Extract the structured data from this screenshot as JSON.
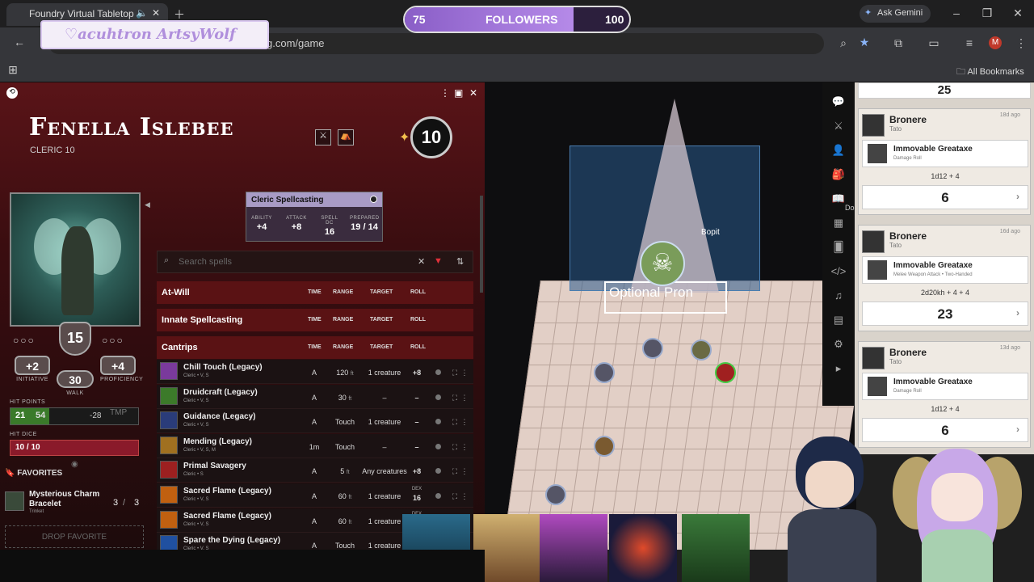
{
  "browser": {
    "tab_title": "Foundry Virtual Tabletop",
    "url": "g.com/game",
    "ask_gemini": "Ask Gemini",
    "all_bookmarks": "All Bookmarks",
    "profile_initial": "M"
  },
  "stream": {
    "banner": "♡acuhtron  ArtsyWolf",
    "followers_label": "FOLLOWERS",
    "followers_current": "75",
    "followers_goal": "100",
    "followers_progress": 0.75
  },
  "sheet": {
    "name": "Fenella Islebee",
    "class_level": "CLERIC 10",
    "level_badge": "10",
    "ac": "15",
    "initiative": "+2",
    "initiative_label": "INITIATIVE",
    "proficiency": "+4",
    "proficiency_label": "PROFICIENCY",
    "walk": "30",
    "walk_label": "WALK",
    "hp_label": "HIT POINTS",
    "hp_current": "21",
    "hp_max": "54",
    "hp_temp_mod": "-28",
    "hp_tmp": "TMP",
    "hd_label": "HIT DICE",
    "hd_value": "10 / 10",
    "favorites_label": "FAVORITES",
    "favorite_item": "Mysterious Charm Bracelet",
    "favorite_type": "Trinket",
    "favorite_uses": "3",
    "favorite_max": "3",
    "drop_favorite": "DROP FAVORITE",
    "casting": {
      "title": "Cleric Spellcasting",
      "ability_label": "ABILITY",
      "ability": "+4",
      "attack_label": "ATTACK",
      "attack": "+8",
      "dc_label": "SPELL DC",
      "dc": "16",
      "prepared_label": "PREPARED",
      "prepared": "19 / 14"
    },
    "search_placeholder": "Search spells",
    "col_time": "TIME",
    "col_range": "RANGE",
    "col_target": "TARGET",
    "col_roll": "ROLL",
    "sections": [
      "At-Will",
      "Innate Spellcasting",
      "Cantrips"
    ],
    "spells": [
      {
        "name": "Chill Touch (Legacy)",
        "sub": "Cleric • V, S",
        "time": "A",
        "range": "120",
        "unit": "ft",
        "target": "1 creature",
        "roll": "+8",
        "color": "#7a3a9c"
      },
      {
        "name": "Druidcraft (Legacy)",
        "sub": "Cleric • V, S",
        "time": "A",
        "range": "30",
        "unit": "ft",
        "target": "–",
        "roll": "–",
        "color": "#3c7a2a"
      },
      {
        "name": "Guidance (Legacy)",
        "sub": "Cleric • V, S",
        "time": "A",
        "range": "Touch",
        "unit": "",
        "target": "1 creature",
        "roll": "–",
        "color": "#2a3c7a"
      },
      {
        "name": "Mending (Legacy)",
        "sub": "Cleric • V, S, M",
        "time": "1m",
        "range": "Touch",
        "unit": "",
        "target": "–",
        "roll": "–",
        "color": "#a07020"
      },
      {
        "name": "Primal Savagery",
        "sub": "Cleric • S",
        "time": "A",
        "range": "5",
        "unit": "ft",
        "target": "Any creatures",
        "roll": "+8",
        "color": "#9c2020"
      },
      {
        "name": "Sacred Flame (Legacy)",
        "sub": "Cleric • V, S",
        "time": "A",
        "range": "60",
        "unit": "ft",
        "target": "1 creature",
        "roll": "16",
        "roll_label": "DEX",
        "color": "#c06010"
      },
      {
        "name": "Sacred Flame (Legacy)",
        "sub": "Cleric • V, S",
        "time": "A",
        "range": "60",
        "unit": "ft",
        "target": "1 creature",
        "roll": "",
        "roll_label": "DEX",
        "color": "#c06010"
      },
      {
        "name": "Spare the Dying (Legacy)",
        "sub": "Cleric • V, S",
        "time": "A",
        "range": "Touch",
        "unit": "",
        "target": "1 creature",
        "roll": "",
        "color": "#2050a0"
      }
    ]
  },
  "map": {
    "label_optional": "Optional Pron",
    "token_name": "Bopit",
    "partial_label": "Do"
  },
  "chat": {
    "top_total": "25",
    "messages": [
      {
        "speaker": "Bronere",
        "sub": "Tato",
        "ago": "18d ago",
        "item": "Immovable Greataxe",
        "item_sub": "Damage Roll",
        "formula": "1d12 + 4",
        "total": "6"
      },
      {
        "speaker": "Bronere",
        "sub": "Tato",
        "ago": "16d ago",
        "item": "Immovable Greataxe",
        "item_sub": "Melee Weapon Attack • Two-Handed",
        "formula": "2d20kh + 4 + 4",
        "total": "23"
      },
      {
        "speaker": "Bronere",
        "sub": "Tato",
        "ago": "13d ago",
        "item": "Immovable Greataxe",
        "item_sub": "Damage Roll",
        "formula": "1d12 + 4",
        "total": "6"
      }
    ]
  }
}
